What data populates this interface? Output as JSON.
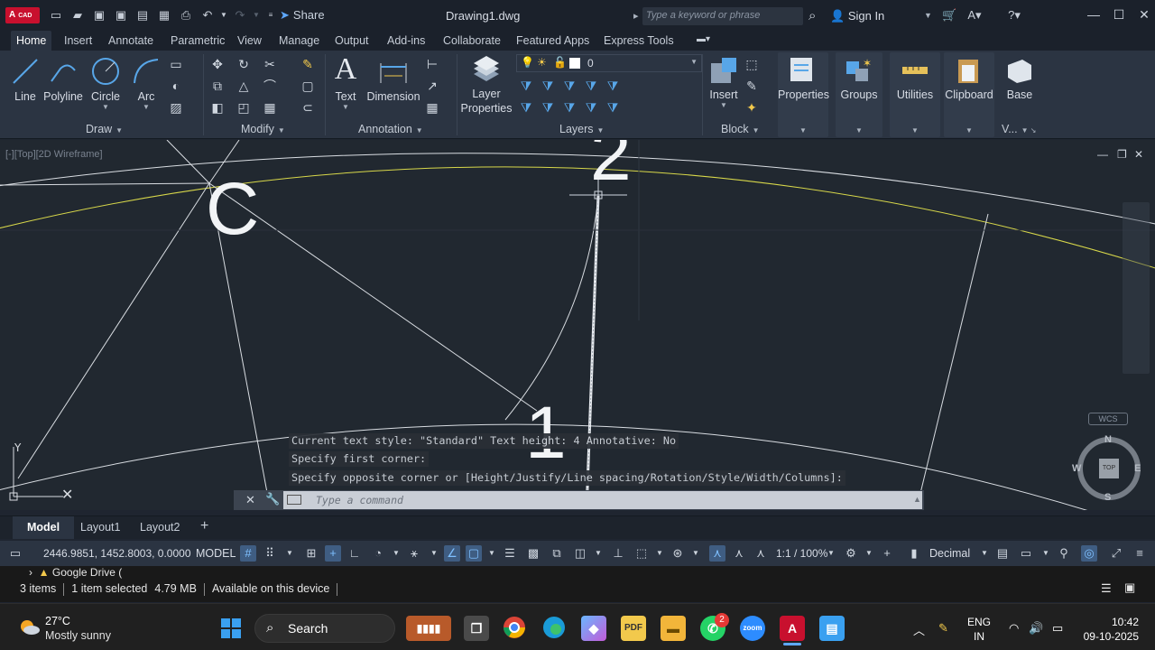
{
  "app": {
    "logo_text": "A",
    "logo_sub": "CAD",
    "share_label": "Share",
    "document_title": "Drawing1.dwg",
    "search_placeholder": "Type a keyword or phrase",
    "signin_label": "Sign In"
  },
  "ribbon_tabs": [
    {
      "label": "Home",
      "active": true
    },
    {
      "label": "Insert"
    },
    {
      "label": "Annotate"
    },
    {
      "label": "Parametric"
    },
    {
      "label": "View"
    },
    {
      "label": "Manage"
    },
    {
      "label": "Output"
    },
    {
      "label": "Add-ins"
    },
    {
      "label": "Collaborate"
    },
    {
      "label": "Featured Apps"
    },
    {
      "label": "Express Tools"
    }
  ],
  "ribbon": {
    "draw": {
      "title": "Draw",
      "tools": [
        "Line",
        "Polyline",
        "Circle",
        "Arc"
      ]
    },
    "modify": {
      "title": "Modify"
    },
    "annotation": {
      "title": "Annotation",
      "tools": [
        "Text",
        "Dimension"
      ]
    },
    "layers": {
      "title": "Layers",
      "tool": "Layer\nProperties",
      "tool_line1": "Layer",
      "tool_line2": "Properties",
      "current_layer": "0"
    },
    "block": {
      "title": "Block",
      "tool": "Insert"
    },
    "properties": {
      "label": "Properties"
    },
    "groups": {
      "label": "Groups"
    },
    "utilities": {
      "label": "Utilities"
    },
    "clipboard": {
      "label": "Clipboard"
    },
    "view": {
      "tool": "Base",
      "title": "V..."
    }
  },
  "viewport": {
    "label": "[-][Top][2D Wireframe]",
    "drawing_texts": [
      "C",
      "2",
      "1"
    ],
    "wcs_label": "WCS",
    "viewcube_face": "TOP",
    "compass": {
      "n": "N",
      "s": "S",
      "e": "E",
      "w": "W"
    }
  },
  "command": {
    "history": [
      "Current text style:  \"Standard\"  Text height:  4  Annotative:  No",
      "Specify first corner:",
      "Specify opposite corner or [Height/Justify/Line spacing/Rotation/Style/Width/Columns]:"
    ],
    "placeholder": "Type a command"
  },
  "layout_tabs": [
    {
      "label": "Model",
      "active": true
    },
    {
      "label": "Layout1"
    },
    {
      "label": "Layout2"
    }
  ],
  "statusbar": {
    "coords": "2446.9851, 1452.8003, 0.0000",
    "model_label": "MODEL",
    "scale": "1:1 / 100%",
    "units": "Decimal"
  },
  "explorer": {
    "nav_item": "Google Drive (",
    "items_count": "3 items",
    "selection": "1 item selected",
    "size": "4.79 MB",
    "availability": "Available on this device"
  },
  "taskbar": {
    "temperature": "27°C",
    "condition": "Mostly sunny",
    "search_label": "Search",
    "whatsapp_badge": "2",
    "lang_line1": "ENG",
    "lang_line2": "IN",
    "time": "10:42",
    "date": "09-10-2025"
  },
  "colors": {
    "accent_blue": "#58a6e8",
    "brand_red": "#c8102e",
    "canvas_bg": "#212830",
    "ribbon_bg": "#2b3442"
  }
}
